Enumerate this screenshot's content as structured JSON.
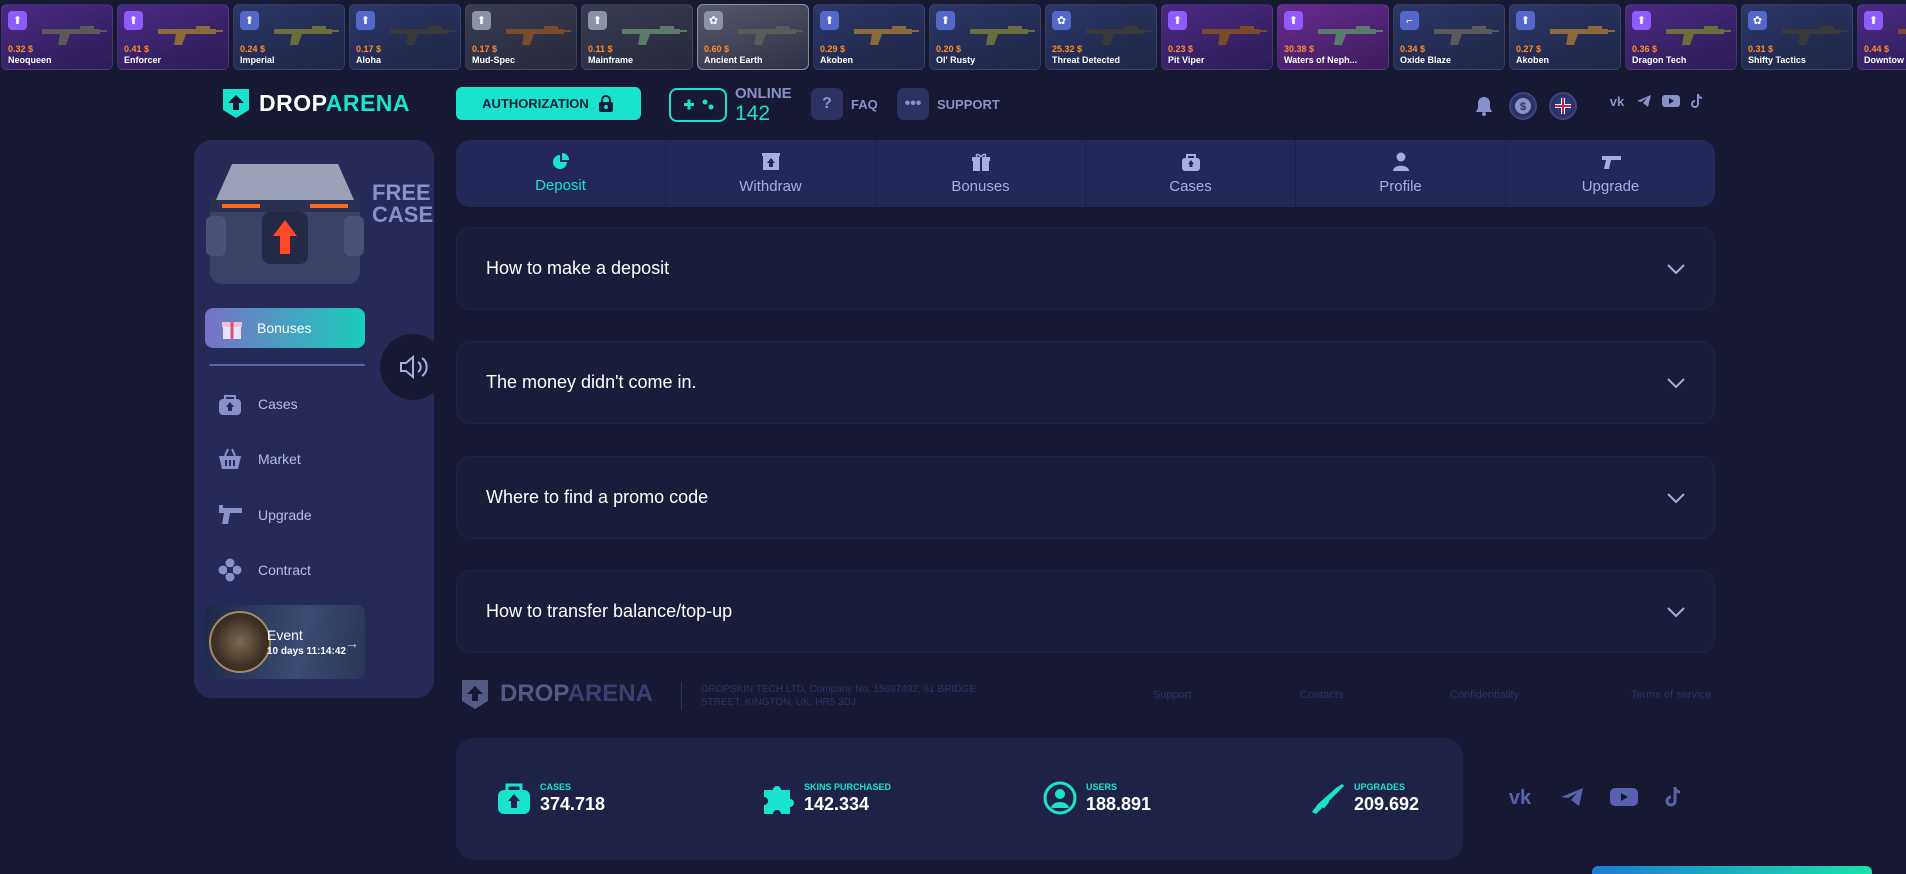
{
  "ticker": [
    {
      "price": "0.32 $",
      "name": "Neoqueen",
      "tone": "purple",
      "badge": "case"
    },
    {
      "price": "0.41 $",
      "name": "Enforcer",
      "tone": "purple",
      "badge": "case"
    },
    {
      "price": "0.24 $",
      "name": "Imperial",
      "tone": "blue",
      "badge": "case"
    },
    {
      "price": "0.17 $",
      "name": "Aloha",
      "tone": "blue",
      "badge": "case"
    },
    {
      "price": "0.17 $",
      "name": "Mud-Spec",
      "tone": "gray",
      "badge": "case"
    },
    {
      "price": "0.11 $",
      "name": "Mainframe",
      "tone": "gray",
      "badge": "case"
    },
    {
      "price": "0.60 $",
      "name": "Ancient Earth",
      "tone": "silver",
      "badge": "contract"
    },
    {
      "price": "0.29 $",
      "name": "Akoben",
      "tone": "blue",
      "badge": "case"
    },
    {
      "price": "0.20 $",
      "name": "Ol' Rusty",
      "tone": "blue",
      "badge": "case"
    },
    {
      "price": "25.32 $",
      "name": "Threat Detected",
      "tone": "blue",
      "badge": "contract"
    },
    {
      "price": "0.23 $",
      "name": "Pit Viper",
      "tone": "purple",
      "badge": "case"
    },
    {
      "price": "30.38 $",
      "name": "Waters of Neph...",
      "tone": "pink",
      "badge": "case"
    },
    {
      "price": "0.34 $",
      "name": "Oxide Blaze",
      "tone": "blue",
      "badge": "upgrade"
    },
    {
      "price": "0.27 $",
      "name": "Akoben",
      "tone": "blue",
      "badge": "case"
    },
    {
      "price": "0.36 $",
      "name": "Dragon Tech",
      "tone": "purple",
      "badge": "case"
    },
    {
      "price": "0.31 $",
      "name": "Shifty Tactics",
      "tone": "blue",
      "badge": "contract"
    },
    {
      "price": "0.44 $",
      "name": "Downtow",
      "tone": "purple",
      "badge": "case"
    }
  ],
  "header": {
    "logo_a": "DROP",
    "logo_b": "ARENA",
    "auth_label": "AUTHORIZATION",
    "online_label": "ONLINE",
    "online_count": "142",
    "faq_label": "FAQ",
    "support_label": "SUPPORT"
  },
  "sidebar": {
    "free_case_1": "FREE",
    "free_case_2": "CASE",
    "bonuses_label": "Bonuses",
    "nav": [
      {
        "label": "Cases",
        "icon": "case-icon"
      },
      {
        "label": "Market",
        "icon": "basket-icon"
      },
      {
        "label": "Upgrade",
        "icon": "upgrade-gun-icon"
      },
      {
        "label": "Contract",
        "icon": "contract-icon"
      }
    ],
    "event_title": "Event",
    "event_time": "10 days 11:14:42"
  },
  "tabs": [
    {
      "label": "Deposit",
      "active": true
    },
    {
      "label": "Withdraw",
      "active": false
    },
    {
      "label": "Bonuses",
      "active": false
    },
    {
      "label": "Cases",
      "active": false
    },
    {
      "label": "Profile",
      "active": false
    },
    {
      "label": "Upgrade",
      "active": false
    }
  ],
  "faq": [
    "How to make a deposit",
    "The money didn't come in.",
    "Where to find a promo code",
    "How to transfer balance/top-up"
  ],
  "footer": {
    "company": "DROPSKIN TECH LTD, Company No: 15697492, 61 BRIDGE STREET, KINGTON, UK, HR5 3DJ",
    "links": [
      "Support",
      "Contacts",
      "Confidentiality",
      "Terms of service"
    ]
  },
  "stats": [
    {
      "label": "CASES",
      "value": "374.718",
      "icon": "case-icon"
    },
    {
      "label": "SKINS PURCHASED",
      "value": "142.334",
      "icon": "puzzle-icon"
    },
    {
      "label": "USERS",
      "value": "188.891",
      "icon": "user-icon"
    },
    {
      "label": "UPGRADES",
      "value": "209.692",
      "icon": "rifle-icon"
    }
  ],
  "colors": {
    "accent": "#19e3cf",
    "background": "#161931",
    "panel": "#272a58",
    "price": "#ff8a2a"
  }
}
